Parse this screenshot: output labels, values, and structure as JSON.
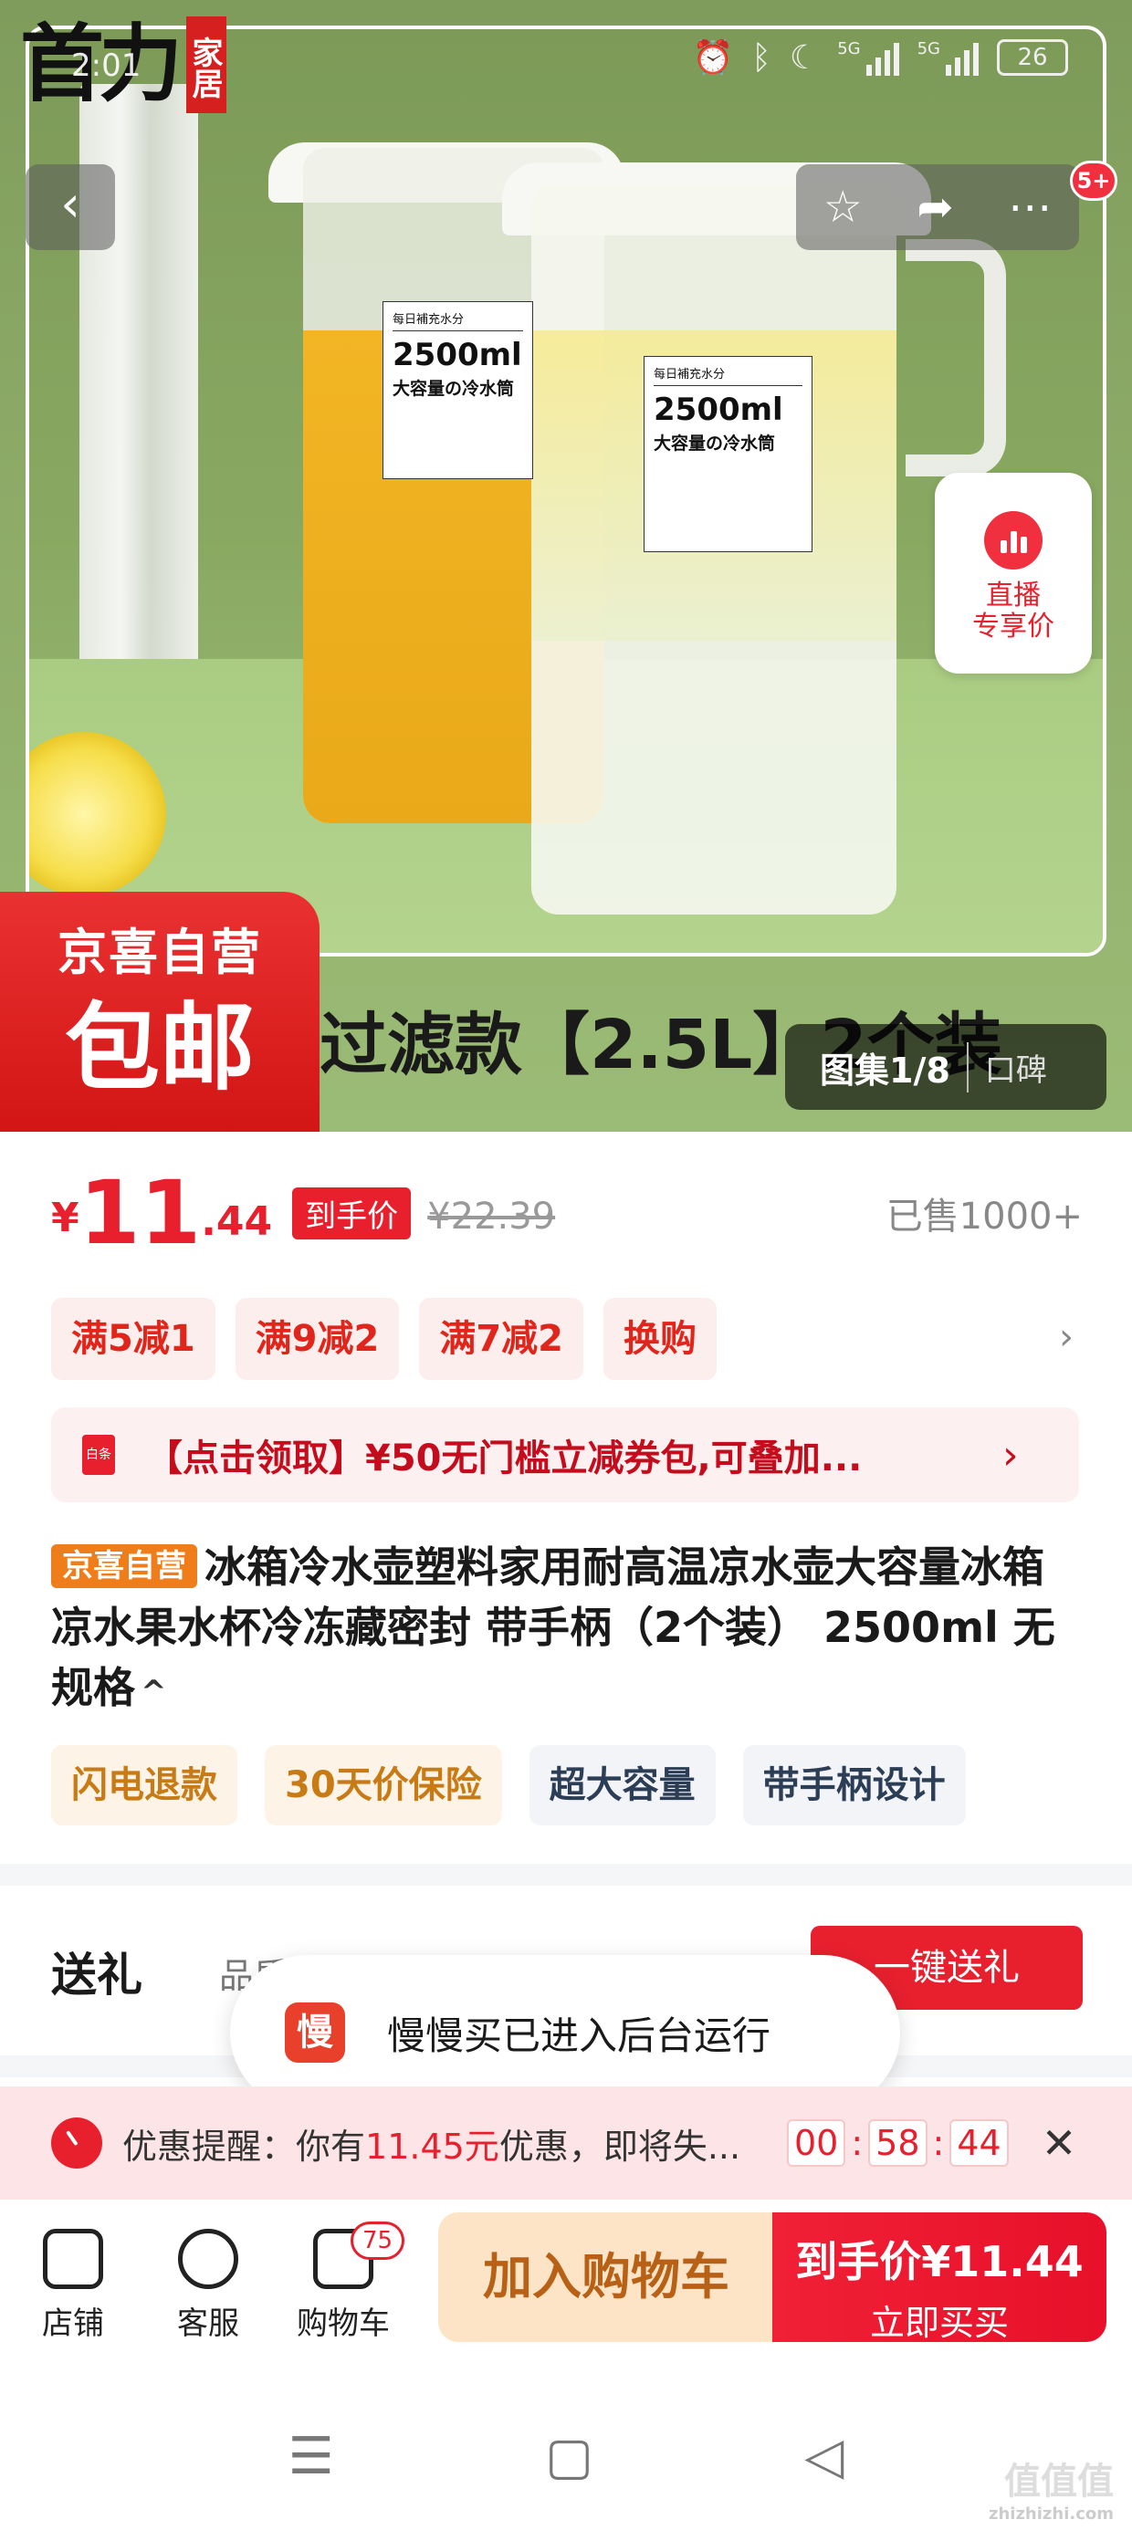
{
  "status_bar": {
    "time": "2:01",
    "network1": "5G",
    "network2": "5G",
    "battery": "26"
  },
  "hero": {
    "brand_main": "首力",
    "brand_sub": "家居",
    "live_badge": {
      "line1": "直播",
      "line2": "专享价"
    },
    "jx_top": "京喜自营",
    "jx_bottom": "包邮",
    "caption": "过滤款【2.5L】2个装",
    "gallery_count": "图集1/8",
    "gallery_tag": "口碑",
    "notif_count": "5+",
    "bottle_labels": {
      "top": "每日補充水分",
      "volume": "2500ml",
      "subtitle": "大容量の冷水筒"
    }
  },
  "price": {
    "yen": "¥",
    "int": "11",
    "dec": ".44",
    "tag": "到手价",
    "orig": "¥22.39",
    "sold": "已售1000+"
  },
  "promotions": [
    "满5减1",
    "满9减2",
    "满7减2",
    "换购"
  ],
  "coupon": {
    "icon": "白条",
    "text": "【点击领取】¥50无门槛立减券包,可叠加..."
  },
  "title": {
    "badge": "京喜自营",
    "text": "冰箱冷水壶塑料家用耐高温凉水壶大容量冰箱凉水果水杯冷冻藏密封 带手柄（2个装） 2500ml 无规格"
  },
  "services": [
    "闪电退款",
    "30天价保险",
    "超大容量",
    "带手柄设计"
  ],
  "gift": {
    "title": "送礼",
    "subtitle": "品质好礼 定制贺卡",
    "button": "一键送礼"
  },
  "toast": {
    "icon": "慢",
    "text": "慢慢买已进入后台运行"
  },
  "reminder": {
    "prefix": "优惠提醒：你有",
    "amount": "11.45元",
    "suffix": "优惠，即将失...",
    "timer": [
      "00",
      "58",
      "44"
    ]
  },
  "bottom_bar": {
    "shop": "店铺",
    "service": "客服",
    "cart": "购物车",
    "cart_count": "75",
    "add_cart": "加入购物车",
    "buy_price": "到手价¥11.44",
    "buy_label": "立即买买"
  },
  "watermark": {
    "text": "值值值",
    "url": "zhizhizhi.com"
  }
}
